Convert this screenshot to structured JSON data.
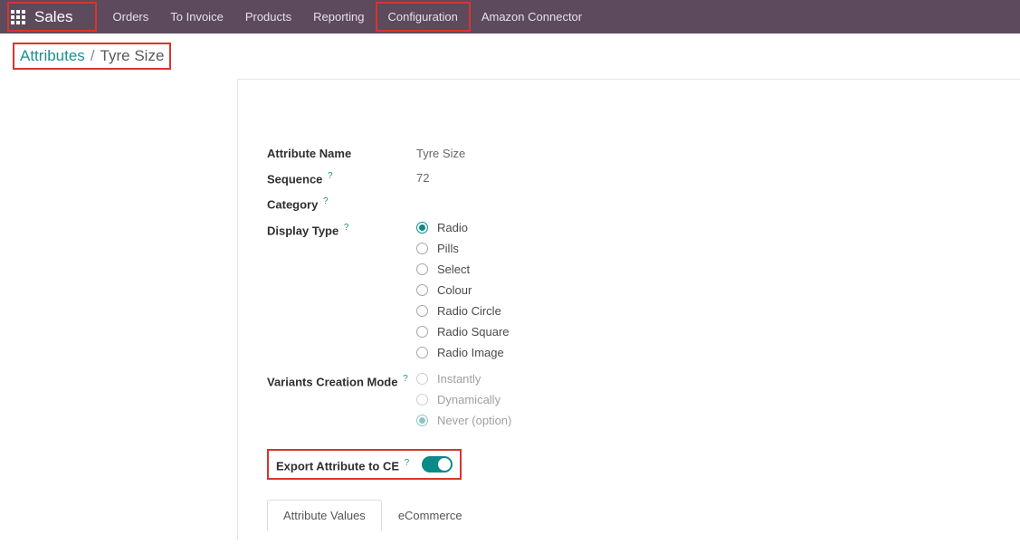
{
  "topbar": {
    "brand": "Sales",
    "nav": [
      {
        "label": "Orders"
      },
      {
        "label": "To Invoice"
      },
      {
        "label": "Products"
      },
      {
        "label": "Reporting"
      },
      {
        "label": "Configuration"
      },
      {
        "label": "Amazon Connector"
      }
    ]
  },
  "breadcrumb": {
    "parent": "Attributes",
    "current": "Tyre Size"
  },
  "form": {
    "attr_name_label": "Attribute Name",
    "attr_name_value": "Tyre Size",
    "sequence_label": "Sequence",
    "sequence_value": "72",
    "category_label": "Category",
    "display_type_label": "Display Type",
    "display_type_options": [
      {
        "label": "Radio",
        "selected": true
      },
      {
        "label": "Pills",
        "selected": false
      },
      {
        "label": "Select",
        "selected": false
      },
      {
        "label": "Colour",
        "selected": false
      },
      {
        "label": "Radio Circle",
        "selected": false
      },
      {
        "label": "Radio Square",
        "selected": false
      },
      {
        "label": "Radio Image",
        "selected": false
      }
    ],
    "variants_label": "Variants Creation Mode",
    "variants_options": [
      {
        "label": "Instantly",
        "selected": false
      },
      {
        "label": "Dynamically",
        "selected": false
      },
      {
        "label": "Never (option)",
        "selected": true
      }
    ],
    "export_label": "Export Attribute to CE",
    "export_value": true
  },
  "tabs": [
    {
      "label": "Attribute Values",
      "active": true
    },
    {
      "label": "eCommerce",
      "active": false
    }
  ]
}
